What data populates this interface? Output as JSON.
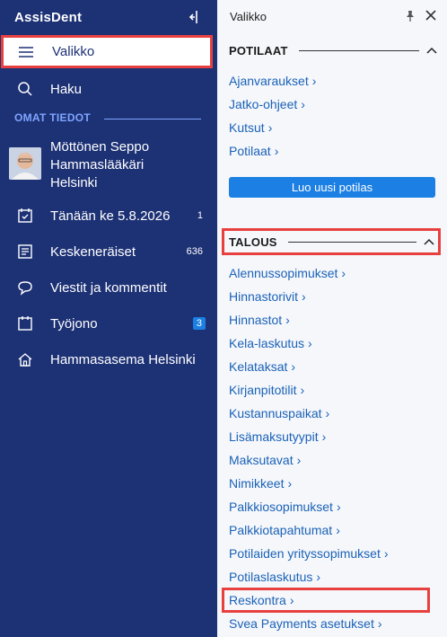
{
  "sidebar": {
    "brand": "AssisDent",
    "menu_label": "Valikko",
    "search_label": "Haku",
    "section_title": "OMAT TIEDOT",
    "user": {
      "name": "Möttönen Seppo",
      "role": "Hammaslääkäri",
      "location": "Helsinki"
    },
    "items": [
      {
        "label": "Tänään ke 5.8.2026",
        "count": "1"
      },
      {
        "label": "Keskeneräiset",
        "count": "636"
      },
      {
        "label": "Viestit ja kommentit",
        "count": ""
      },
      {
        "label": "Työjono",
        "badge": "3"
      },
      {
        "label": "Hammasasema Helsinki",
        "count": ""
      }
    ]
  },
  "panel": {
    "title": "Valikko",
    "potilaat": {
      "title": "POTILAAT",
      "links": [
        "Ajanvaraukset",
        "Jatko-ohjeet",
        "Kutsut",
        "Potilaat"
      ],
      "button": "Luo uusi potilas"
    },
    "talous": {
      "title": "TALOUS",
      "links": [
        "Alennussopimukset",
        "Hinnastorivit",
        "Hinnastot",
        "Kela-laskutus",
        "Kelataksat",
        "Kirjanpitotilit",
        "Kustannuspaikat",
        "Lisämaksutyypit",
        "Maksutavat",
        "Nimikkeet",
        "Palkkiosopimukset",
        "Palkkiotapahtumat",
        "Potilaiden yrityssopimukset",
        "Potilaslaskutus",
        "Reskontra",
        "Svea Payments asetukset"
      ]
    },
    "arrow": "›"
  }
}
